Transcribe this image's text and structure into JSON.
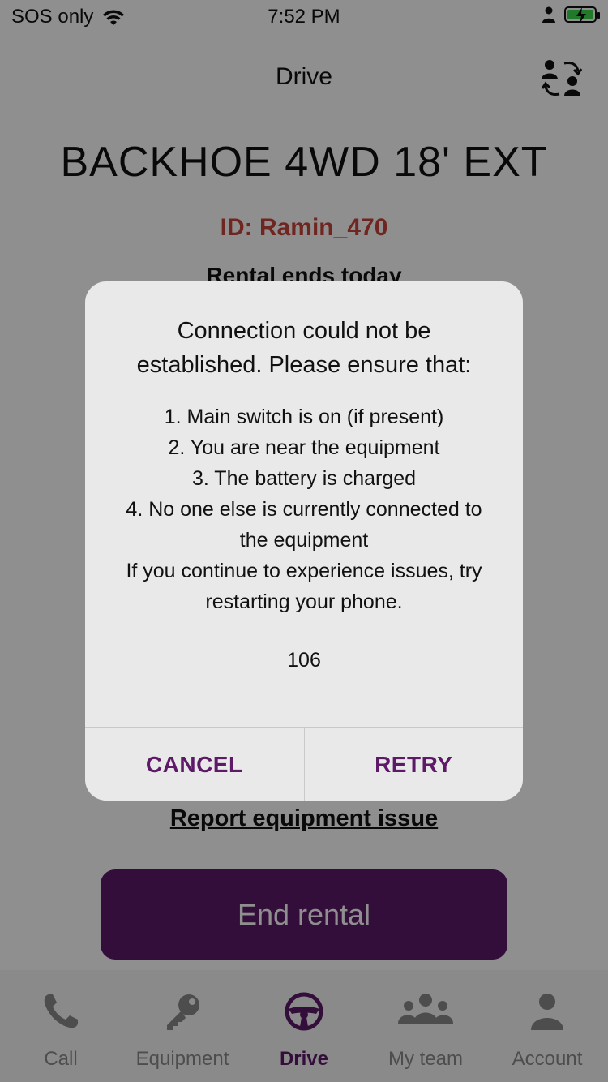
{
  "status_bar": {
    "carrier": "SOS only",
    "time": "7:52 PM"
  },
  "header": {
    "title": "Drive",
    "switch_icon": "team-switch-icon"
  },
  "equipment": {
    "name": "BACKHOE 4WD 18' EXT",
    "id_label": "ID: Ramin_470",
    "rental_status": "Rental ends today"
  },
  "actions": {
    "report_link": "Report equipment issue",
    "end_rental": "End rental"
  },
  "tabs": [
    {
      "label": "Call",
      "icon": "phone-icon"
    },
    {
      "label": "Equipment",
      "icon": "key-icon"
    },
    {
      "label": "Drive",
      "icon": "steering-wheel-icon",
      "active": true
    },
    {
      "label": "My team",
      "icon": "team-icon"
    },
    {
      "label": "Account",
      "icon": "account-icon"
    }
  ],
  "dialog": {
    "title_line1": "Connection could not be",
    "title_line2": "established. Please ensure that:",
    "lines": [
      "1. Main switch is on (if present)",
      "2. You are near the equipment",
      "3. The battery is charged",
      "4. No one else is currently connected to",
      "the equipment",
      "If you continue to experience issues, try",
      "restarting your phone."
    ],
    "code": "106",
    "cancel_label": "CANCEL",
    "retry_label": "RETRY"
  },
  "colors": {
    "brand_purple": "#5e1a68",
    "id_red": "#c8453a",
    "battery_green": "#3cd84b"
  }
}
